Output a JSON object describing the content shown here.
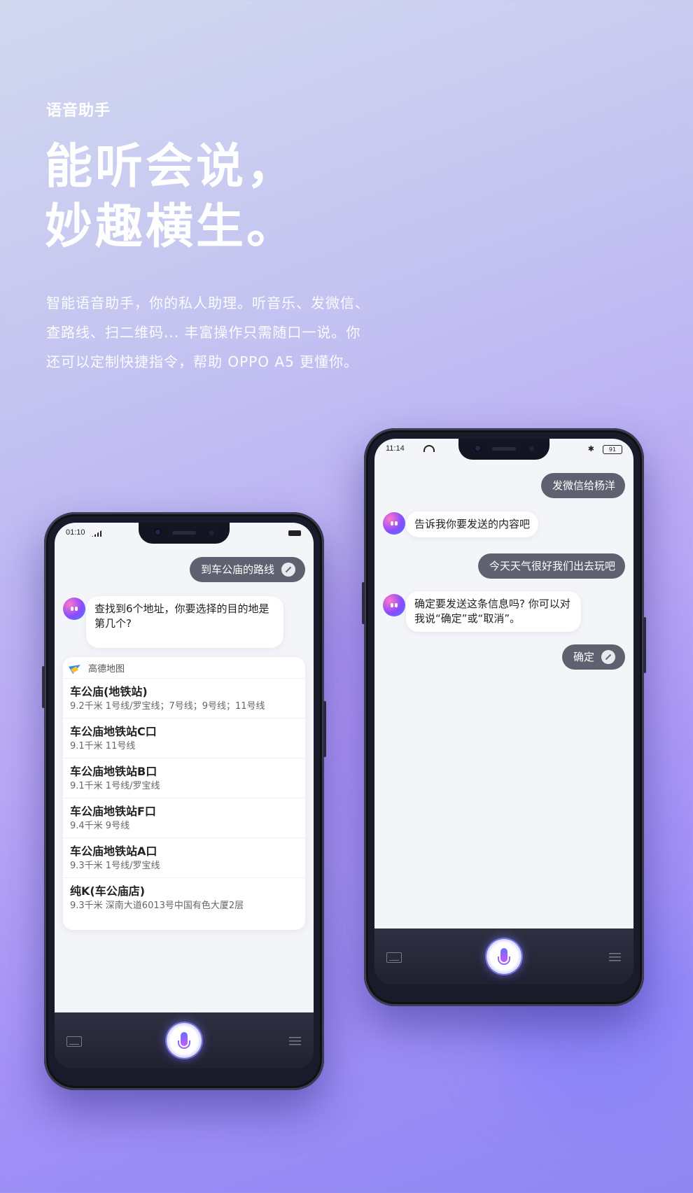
{
  "hero": {
    "eyebrow": "语音助手",
    "title_line1": "能听会说，",
    "title_line2": "妙趣横生。",
    "desc_line1": "智能语音助手，你的私人助理。听音乐、发微信、",
    "desc_line2": "查路线、扫二维码... 丰富操作只需随口一说。你",
    "desc_line3": "还可以定制快捷指令，帮助 OPPO A5 更懂你。"
  },
  "phone_left": {
    "status_time": "01:10",
    "user_query": "到车公庙的路线",
    "assistant_reply": "查找到6个地址，你要选择的目的地是第几个?",
    "map_app_name": "高德地图",
    "results": [
      {
        "name": "车公庙(地铁站)",
        "detail": "9.2千米  1号线/罗宝线；7号线；9号线；11号线"
      },
      {
        "name": "车公庙地铁站C口",
        "detail": "9.1千米  11号线"
      },
      {
        "name": "车公庙地铁站B口",
        "detail": "9.1千米  1号线/罗宝线"
      },
      {
        "name": "车公庙地铁站F口",
        "detail": "9.4千米  9号线"
      },
      {
        "name": "车公庙地铁站A口",
        "detail": "9.3千米  1号线/罗宝线"
      },
      {
        "name": "纯K(车公庙店)",
        "detail": "9.3千米  深南大道6013号中国有色大厦2层"
      }
    ]
  },
  "phone_right": {
    "status_time": "11:14",
    "status_battery": "91",
    "msg1_user": "发微信给杨洋",
    "msg2_bot": "告诉我你要发送的内容吧",
    "msg3_user": "今天天气很好我们出去玩吧",
    "msg4_bot": "确定要发送这条信息吗? 你可以对我说“确定”或“取消”。",
    "msg5_user": "确定"
  },
  "icons": {
    "edit": "edit-icon",
    "keyboard": "keyboard-icon",
    "mic": "microphone-icon",
    "menu": "menu-icon",
    "assistant": "assistant-avatar-icon",
    "map": "amap-logo-icon"
  },
  "colors": {
    "user_bubble": "#5e6270",
    "bot_bubble": "#ffffff",
    "phone_frame": "#1a1b2a",
    "accent": "#8a4bff"
  }
}
